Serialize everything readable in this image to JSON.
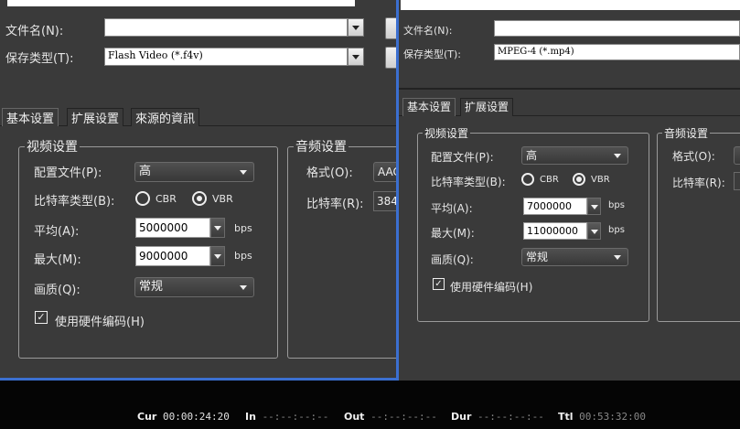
{
  "left": {
    "filename_label": "文件名(N):",
    "filename_value": "",
    "savetype_label": "保存类型(T):",
    "savetype_value": "Flash Video (*.f4v)",
    "tabs": [
      "基本设置",
      "扩展设置",
      "來源的資訊"
    ],
    "video": {
      "title": "视频设置",
      "profile_label": "配置文件(P):",
      "profile_value": "高",
      "bitrate_type_label": "比特率类型(B):",
      "cbr": "CBR",
      "vbr": "VBR",
      "avg_label": "平均(A):",
      "avg_value": "5000000",
      "max_label": "最大(M):",
      "max_value": "9000000",
      "unit": "bps",
      "quality_label": "画质(Q):",
      "quality_value": "常规",
      "hw_label": "使用硬件编码(H)",
      "check_mark": "✓"
    },
    "audio": {
      "title": "音频设置",
      "format_label": "格式(O):",
      "format_value": "AAC",
      "bitrate_label": "比特率(R):",
      "bitrate_value": "384"
    }
  },
  "right": {
    "filename_label": "文件名(N):",
    "filename_value": "",
    "savetype_label": "保存类型(T):",
    "savetype_value": "MPEG-4 (*.mp4)",
    "tabs": [
      "基本设置",
      "扩展设置"
    ],
    "video": {
      "title": "视频设置",
      "profile_label": "配置文件(P):",
      "profile_value": "高",
      "bitrate_type_label": "比特率类型(B):",
      "cbr": "CBR",
      "vbr": "VBR",
      "avg_label": "平均(A):",
      "avg_value": "7000000",
      "max_label": "最大(M):",
      "max_value": "11000000",
      "unit": "bps",
      "quality_label": "画质(Q):",
      "quality_value": "常规",
      "hw_label": "使用硬件编码(H)",
      "check_mark": "✓"
    },
    "audio": {
      "title": "音频设置",
      "format_label": "格式(O):",
      "bitrate_label": "比特率(R):"
    }
  },
  "status": {
    "cur_label": "Cur",
    "cur_value": "00:00:24:20",
    "in_label": "In",
    "in_value": "--:--:--:--",
    "out_label": "Out",
    "out_value": "--:--:--:--",
    "dur_label": "Dur",
    "dur_value": "--:--:--:--",
    "ttl_label": "Ttl",
    "ttl_value": "00:53:32:00"
  },
  "colors": {
    "panel_bg": "#3a3a3a",
    "window_border": "#3b6fd0",
    "status_bg": "#050505"
  }
}
